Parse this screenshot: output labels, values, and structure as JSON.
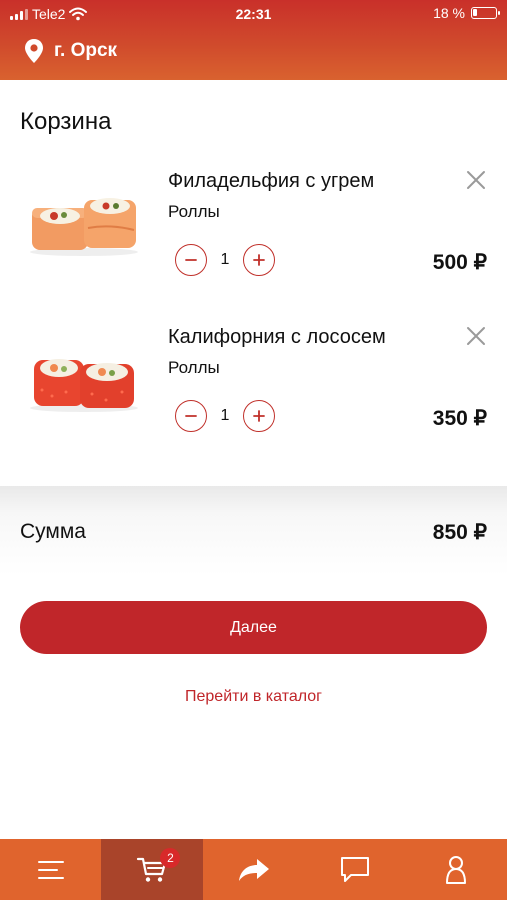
{
  "status_bar": {
    "carrier": "Tele2",
    "time": "22:31",
    "battery": "18 %",
    "battery_level": 0.18
  },
  "header": {
    "city": "г. Орск"
  },
  "cart": {
    "title": "Корзина",
    "items": [
      {
        "name": "Филадельфия с угрем",
        "category": "Роллы",
        "quantity": "1",
        "price": "500 ₽"
      },
      {
        "name": "Калифорния с лососем",
        "category": "Роллы",
        "quantity": "1",
        "price": "350 ₽"
      }
    ],
    "total_label": "Сумма",
    "total_value": "850 ₽",
    "next_button": "Далее",
    "catalog_link": "Перейти в каталог"
  },
  "tabbar": {
    "cart_badge": "2",
    "tabs": [
      "menu-icon",
      "cart-icon",
      "share-icon",
      "chat-icon",
      "profile-icon"
    ]
  },
  "colors": {
    "accent": "#c0262a",
    "header_top": "#c9302a",
    "tabbar": "#e0642d",
    "tab_active": "#a9442a"
  }
}
